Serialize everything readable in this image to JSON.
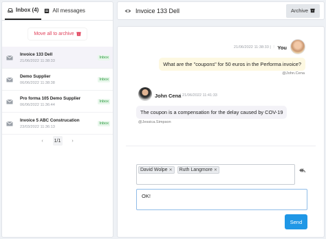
{
  "tabs": [
    {
      "label": "Inbox (4)",
      "icon": "inbox-icon",
      "active": true
    },
    {
      "label": "All messages",
      "icon": "messages-icon",
      "active": false
    }
  ],
  "move_all_label": "Move all to archive",
  "messages": [
    {
      "name": "Invoice 133 Dell",
      "date": "21/06/2022 11:38:33",
      "badge": "Inbox",
      "selected": true
    },
    {
      "name": "Demo Supplier",
      "date": "06/06/2022 11:38:38",
      "badge": "Inbox",
      "selected": false
    },
    {
      "name": "Pro forma 105 Demo Supplier",
      "date": "06/06/2022 11:36:44",
      "badge": "Inbox",
      "selected": false
    },
    {
      "name": "Invoice 5 ABC Construcation",
      "date": "23/03/2022 11:36:13",
      "badge": "Inbox",
      "selected": false
    }
  ],
  "pager": {
    "prev": "‹",
    "current": "1/1",
    "next": "›"
  },
  "header": {
    "title": "Invoice 133 Dell",
    "archive_label": "Archive"
  },
  "conversation": {
    "msg1": {
      "meta": "21/06/2022 11:38:33 | ⋮",
      "author": "You",
      "text": "What are the \"coupons\" for 50 euros in the Performa invoice?",
      "by": "@John.Cena"
    },
    "msg2": {
      "author": "John Cena",
      "meta": "| 21/06/2022 11:41:33",
      "text": "The coupon is a compensation for the delay caused by COV-19",
      "by": "@Jessica.Simpson"
    }
  },
  "recipients": [
    "David Wolpe",
    "Ruth Langmore"
  ],
  "reply": {
    "value": "OK!"
  },
  "send_label": "Send",
  "colors": {
    "accent": "#1f97e6",
    "danger": "#e0405a",
    "badge": "#2a9b3e"
  }
}
